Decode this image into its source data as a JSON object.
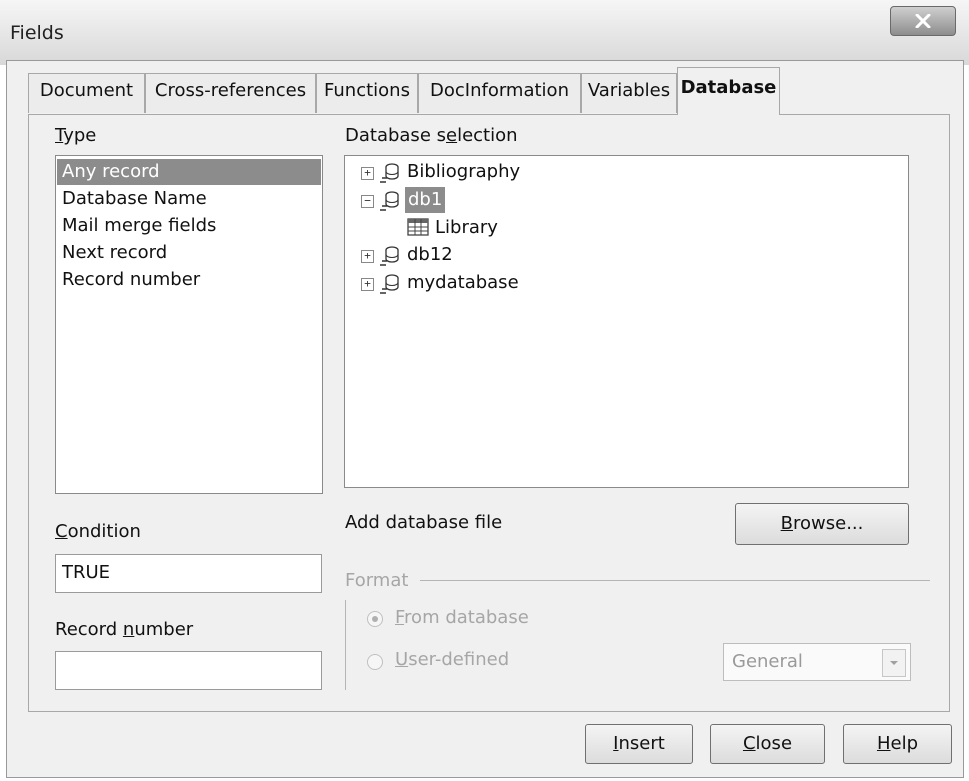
{
  "window": {
    "title": "Fields"
  },
  "tabs": [
    {
      "label": "Document"
    },
    {
      "label": "Cross-references"
    },
    {
      "label": "Functions"
    },
    {
      "label": "DocInformation"
    },
    {
      "label": "Variables"
    },
    {
      "label": "Database",
      "active": true
    }
  ],
  "type": {
    "label_mnemonic": "T",
    "label_rest": "ype",
    "items": [
      "Any record",
      "Database Name",
      "Mail merge fields",
      "Next record",
      "Record number"
    ],
    "selected_index": 0
  },
  "database_selection": {
    "label_pre": "Database s",
    "label_mnemonic": "e",
    "label_post": "lection",
    "tree": [
      {
        "label": "Bibliography",
        "toggle": "+",
        "icon": "database-icon"
      },
      {
        "label": "db1",
        "toggle": "-",
        "icon": "database-icon",
        "selected": true
      },
      {
        "label": "Library",
        "icon": "table-icon"
      },
      {
        "label": "db12",
        "toggle": "+",
        "icon": "database-icon"
      },
      {
        "label": "mydatabase",
        "toggle": "+",
        "icon": "database-icon"
      }
    ]
  },
  "add_database": {
    "label": "Add database file",
    "browse_mnemonic": "B",
    "browse_rest": "rowse..."
  },
  "condition": {
    "label_mnemonic": "C",
    "label_rest": "ondition",
    "value": "TRUE"
  },
  "record_number": {
    "label_pre": "Record ",
    "label_mnemonic": "n",
    "label_post": "umber",
    "value": ""
  },
  "format": {
    "label": "Format",
    "from_database": {
      "mnemonic": "F",
      "rest": "rom database",
      "checked": true
    },
    "user_defined": {
      "mnemonic": "U",
      "rest": "ser-defined",
      "checked": false
    },
    "select_value": "General"
  },
  "buttons": {
    "insert": {
      "mnemonic": "I",
      "rest": "nsert"
    },
    "close": {
      "mnemonic": "C",
      "rest": "lose"
    },
    "help": {
      "mnemonic": "H",
      "rest": "elp"
    }
  },
  "colors": {
    "selection": "#8c8c8c",
    "dialog_bg": "#f0f0f0"
  }
}
